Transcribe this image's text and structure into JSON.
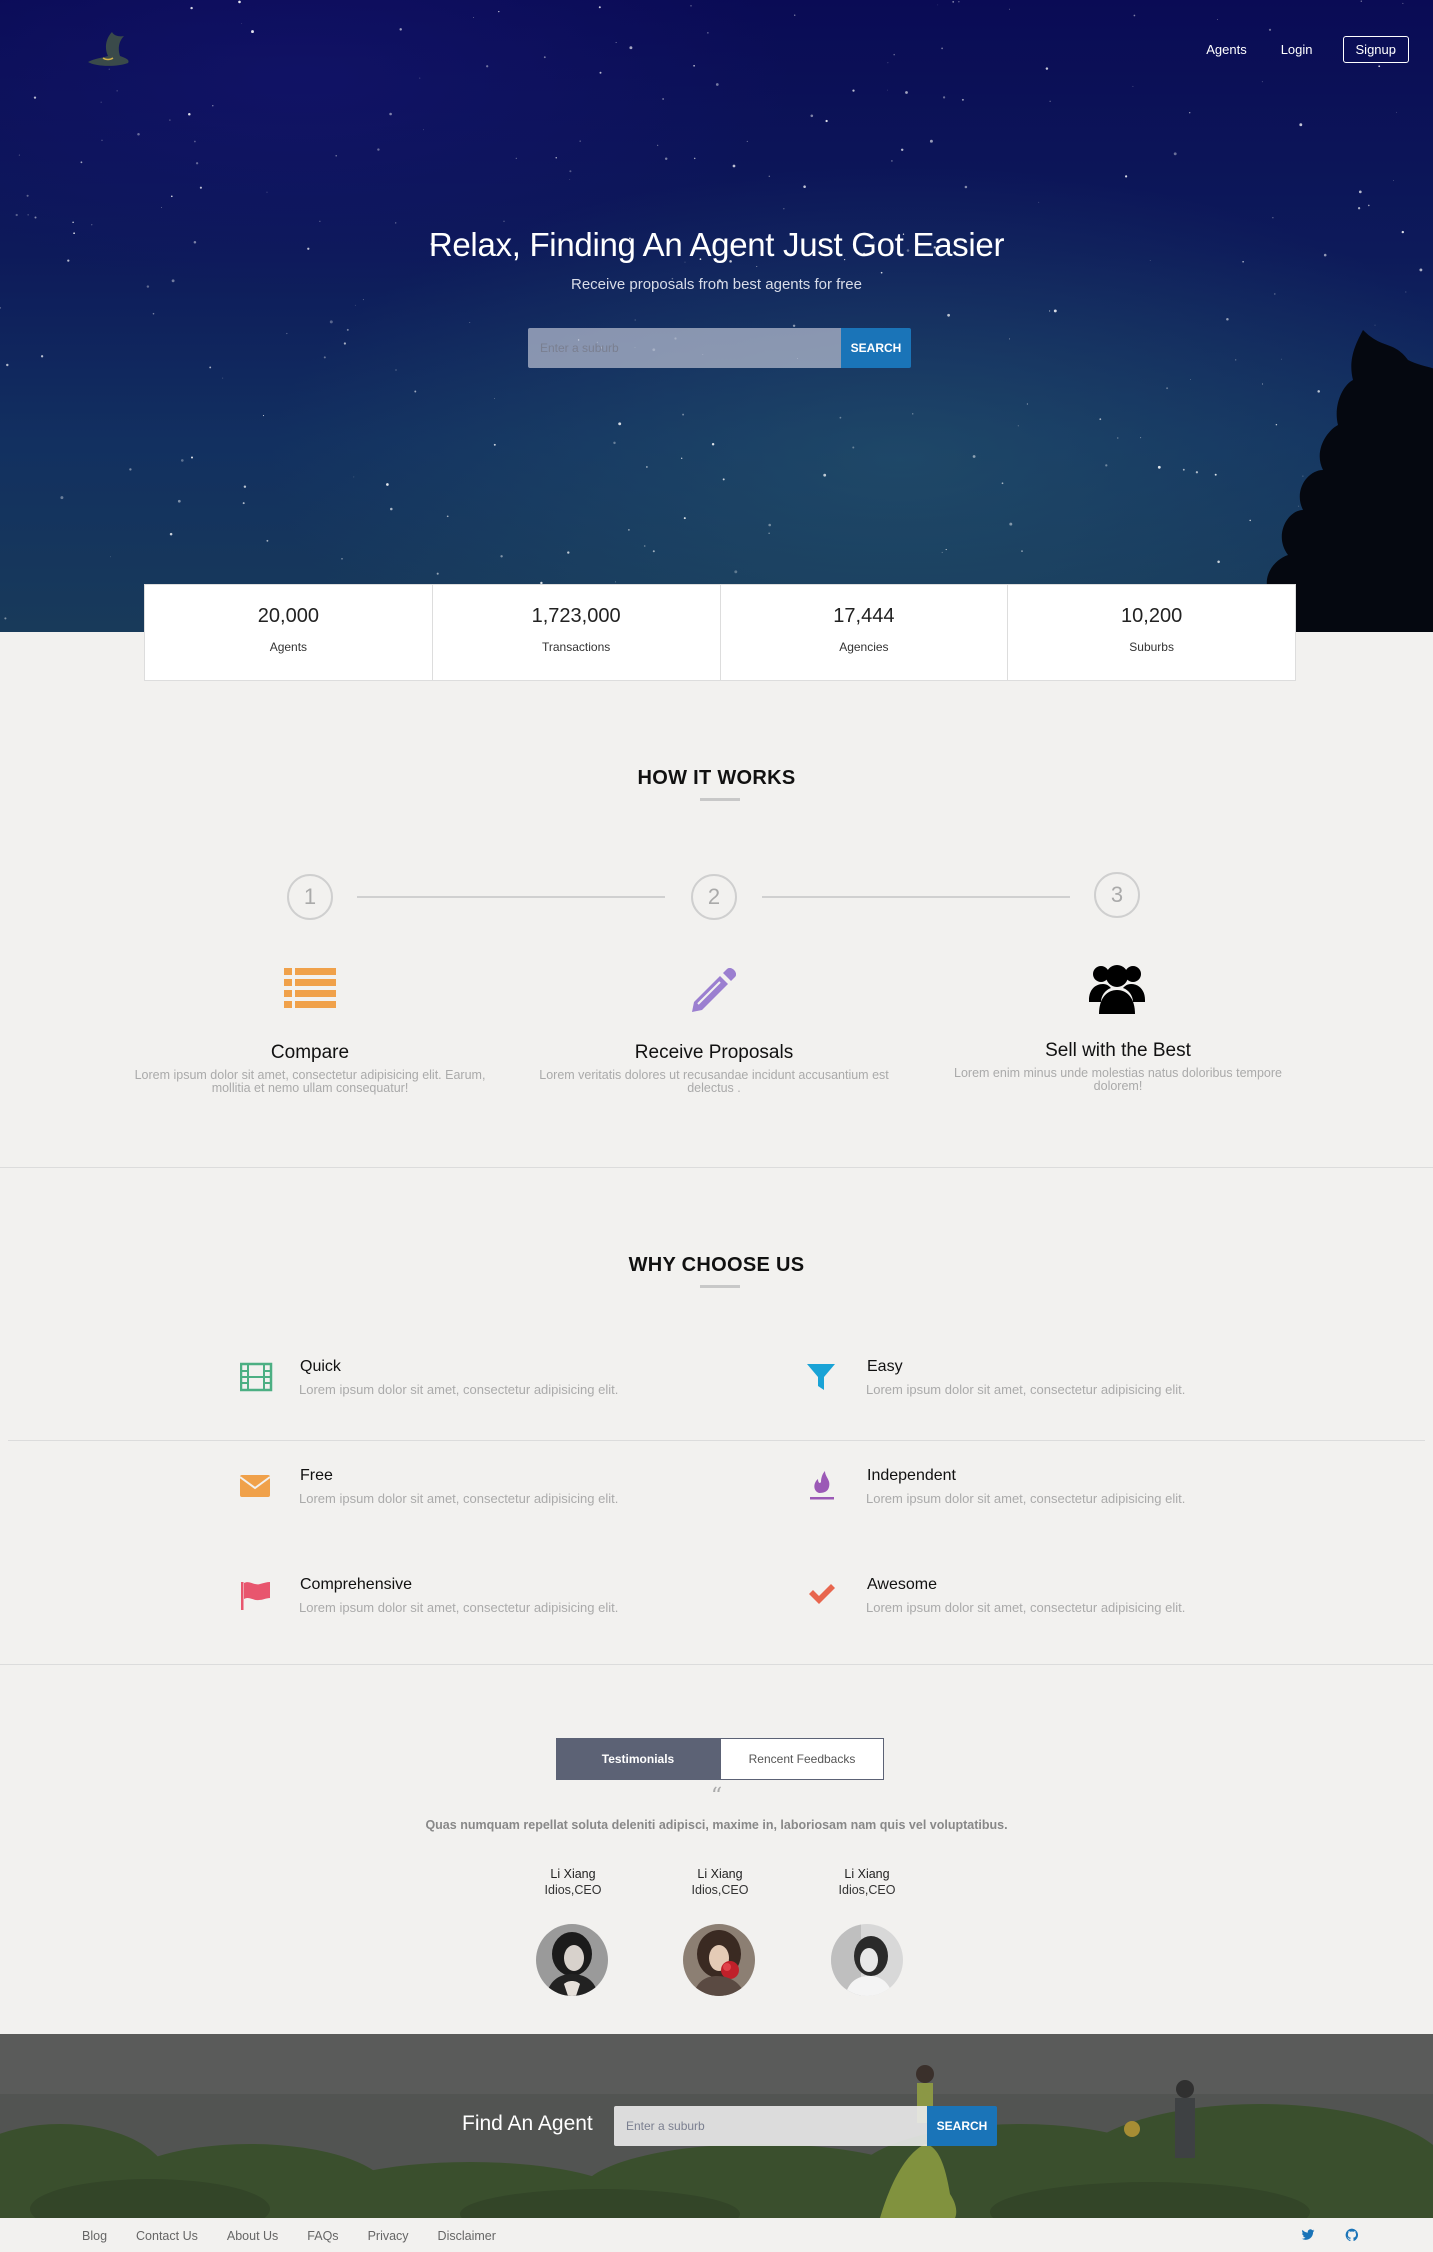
{
  "nav": {
    "agents": "Agents",
    "login": "Login",
    "signup": "Signup"
  },
  "hero": {
    "title": "Relax, Finding An Agent Just Got Easier",
    "subtitle": "Receive proposals from best agents for free",
    "search_placeholder": "Enter a suburb",
    "search_button": "SEARCH"
  },
  "stats": [
    {
      "value": "20,000",
      "label": "Agents"
    },
    {
      "value": "1,723,000",
      "label": "Transactions"
    },
    {
      "value": "17,444",
      "label": "Agencies"
    },
    {
      "value": "10,200",
      "label": "Suburbs"
    }
  ],
  "how_it_works": {
    "title": "HOW IT WORKS",
    "steps": [
      {
        "number": "1",
        "title": "Compare",
        "desc": "Lorem ipsum dolor sit amet, consectetur adipisicing elit. Earum, mollitia et nemo ullam consequatur!",
        "icon": "list-icon",
        "color": "#f0a14a"
      },
      {
        "number": "2",
        "title": "Receive Proposals",
        "desc": "Lorem veritatis dolores ut recusandae incidunt accusantium est delectus .",
        "icon": "pencil-icon",
        "color": "#9b7fd0"
      },
      {
        "number": "3",
        "title": "Sell with the Best",
        "desc": "Lorem enim minus unde molestias natus doloribus tempore dolorem!",
        "icon": "users-icon",
        "color": "#000000"
      }
    ]
  },
  "why_choose_us": {
    "title": "WHY CHOOSE US",
    "features": [
      {
        "title": "Quick",
        "desc": "Lorem ipsum dolor sit amet, consectetur adipisicing elit.",
        "icon": "film-icon",
        "color": "#4caf83"
      },
      {
        "title": "Easy",
        "desc": "Lorem ipsum dolor sit amet, consectetur adipisicing elit.",
        "icon": "filter-icon",
        "color": "#1aa3d6"
      },
      {
        "title": "Free",
        "desc": "Lorem ipsum dolor sit amet, consectetur adipisicing elit.",
        "icon": "envelope-icon",
        "color": "#f0a14a"
      },
      {
        "title": "Independent",
        "desc": "Lorem ipsum dolor sit amet, consectetur adipisicing elit.",
        "icon": "fire-icon",
        "color": "#9b59b6"
      },
      {
        "title": "Comprehensive",
        "desc": "Lorem ipsum dolor sit amet, consectetur adipisicing elit.",
        "icon": "flag-icon",
        "color": "#e8566e"
      },
      {
        "title": "Awesome",
        "desc": "Lorem ipsum dolor sit amet, consectetur adipisicing elit.",
        "icon": "check-icon",
        "color": "#e8664e"
      }
    ]
  },
  "testimonials": {
    "tabs": [
      "Testimonials",
      "Rencent Feedbacks"
    ],
    "quote_mark": "“",
    "quote": "Quas numquam repellat soluta deleniti adipisci, maxime in, laboriosam nam quis vel voluptatibus.",
    "people": [
      {
        "name": "Li Xiang",
        "role": "Idios,CEO"
      },
      {
        "name": "Li Xiang",
        "role": "Idios,CEO"
      },
      {
        "name": "Li Xiang",
        "role": "Idios,CEO"
      }
    ]
  },
  "find_agent": {
    "title": "Find An Agent",
    "search_placeholder": "Enter a suburb",
    "search_button": "SEARCH"
  },
  "footer": {
    "links": [
      "Blog",
      "Contact Us",
      "About Us",
      "FAQs",
      "Privacy",
      "Disclaimer"
    ],
    "social": [
      "twitter-icon",
      "github-icon"
    ]
  }
}
